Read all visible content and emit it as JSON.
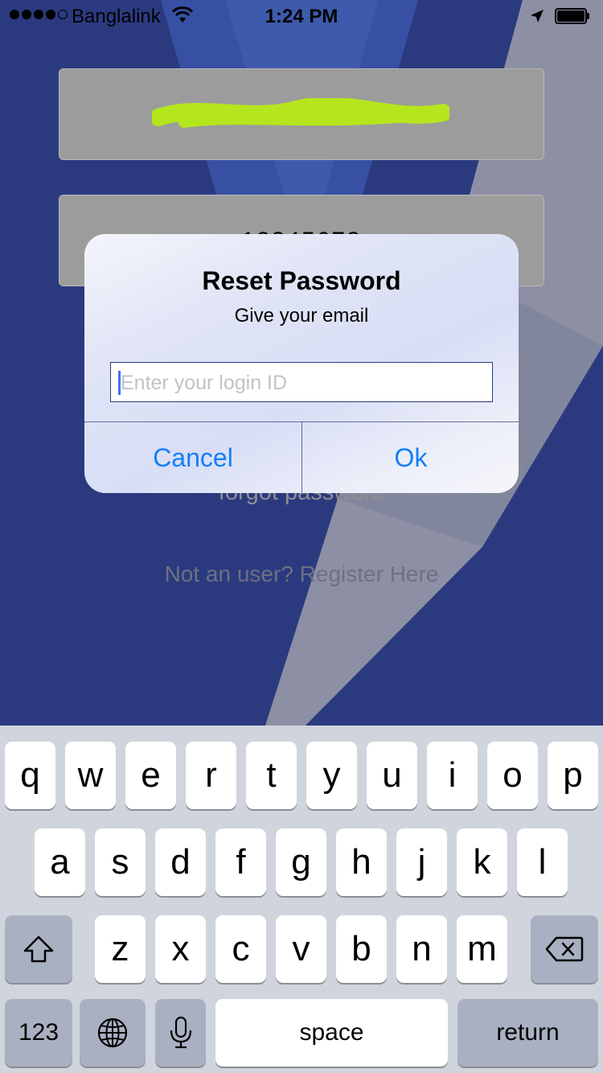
{
  "status_bar": {
    "carrier": "Banglalink",
    "time": "1:24 PM"
  },
  "background_form": {
    "password_value": "12345678",
    "forgot_password_link": "forgot password",
    "register_link": "Not an user? Register Here"
  },
  "alert": {
    "title": "Reset Password",
    "message": "Give your email",
    "input_placeholder": "Enter your login ID",
    "cancel_label": "Cancel",
    "ok_label": "Ok"
  },
  "keyboard": {
    "row1": [
      "q",
      "w",
      "e",
      "r",
      "t",
      "y",
      "u",
      "i",
      "o",
      "p"
    ],
    "row2": [
      "a",
      "s",
      "d",
      "f",
      "g",
      "h",
      "j",
      "k",
      "l"
    ],
    "row3": [
      "z",
      "x",
      "c",
      "v",
      "b",
      "n",
      "m"
    ],
    "numbers_label": "123",
    "space_label": "space",
    "return_label": "return"
  },
  "icons": [
    "wifi-icon",
    "location-arrow-icon",
    "battery-icon",
    "shift-icon",
    "backspace-icon",
    "globe-icon",
    "microphone-icon"
  ],
  "colors": {
    "background_blue": "#2b3a7f",
    "accent_blue": "#147efb",
    "scribble_green": "#b5e61d",
    "keyboard_bg": "#d0d4dc"
  }
}
